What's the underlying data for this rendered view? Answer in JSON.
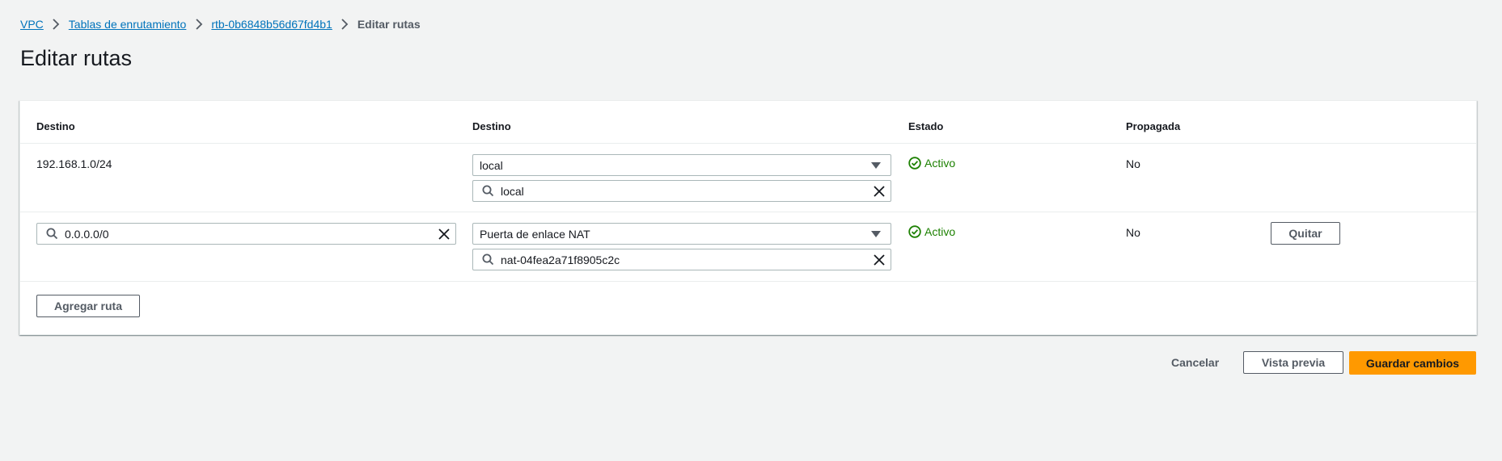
{
  "breadcrumb": {
    "items": [
      "VPC",
      "Tablas de enrutamiento",
      "rtb-0b6848b56d67fd4b1"
    ],
    "current": "Editar rutas"
  },
  "page_title": "Editar rutas",
  "table": {
    "headers": [
      "Destino",
      "Destino",
      "Estado",
      "Propagada"
    ],
    "rows": [
      {
        "destination": "192.168.1.0/24",
        "target_type": "local",
        "target_id": "local",
        "status": "Activo",
        "propagated": "No"
      },
      {
        "destination": "0.0.0.0/0",
        "target_type": "Puerta de enlace NAT",
        "target_id": "nat-04fea2a71f8905c2c",
        "status": "Activo",
        "propagated": "No",
        "remove_label": "Quitar"
      }
    ],
    "add_route_label": "Agregar ruta"
  },
  "footer": {
    "cancel_label": "Cancelar",
    "preview_label": "Vista previa",
    "save_label": "Guardar cambios"
  },
  "colors": {
    "link": "#0073bb",
    "success": "#1d8102",
    "primary": "#ff9900",
    "background": "#f2f3f3"
  },
  "icons": [
    "chevron-right-icon",
    "search-icon",
    "close-icon",
    "caret-down-icon",
    "status-success-icon"
  ]
}
